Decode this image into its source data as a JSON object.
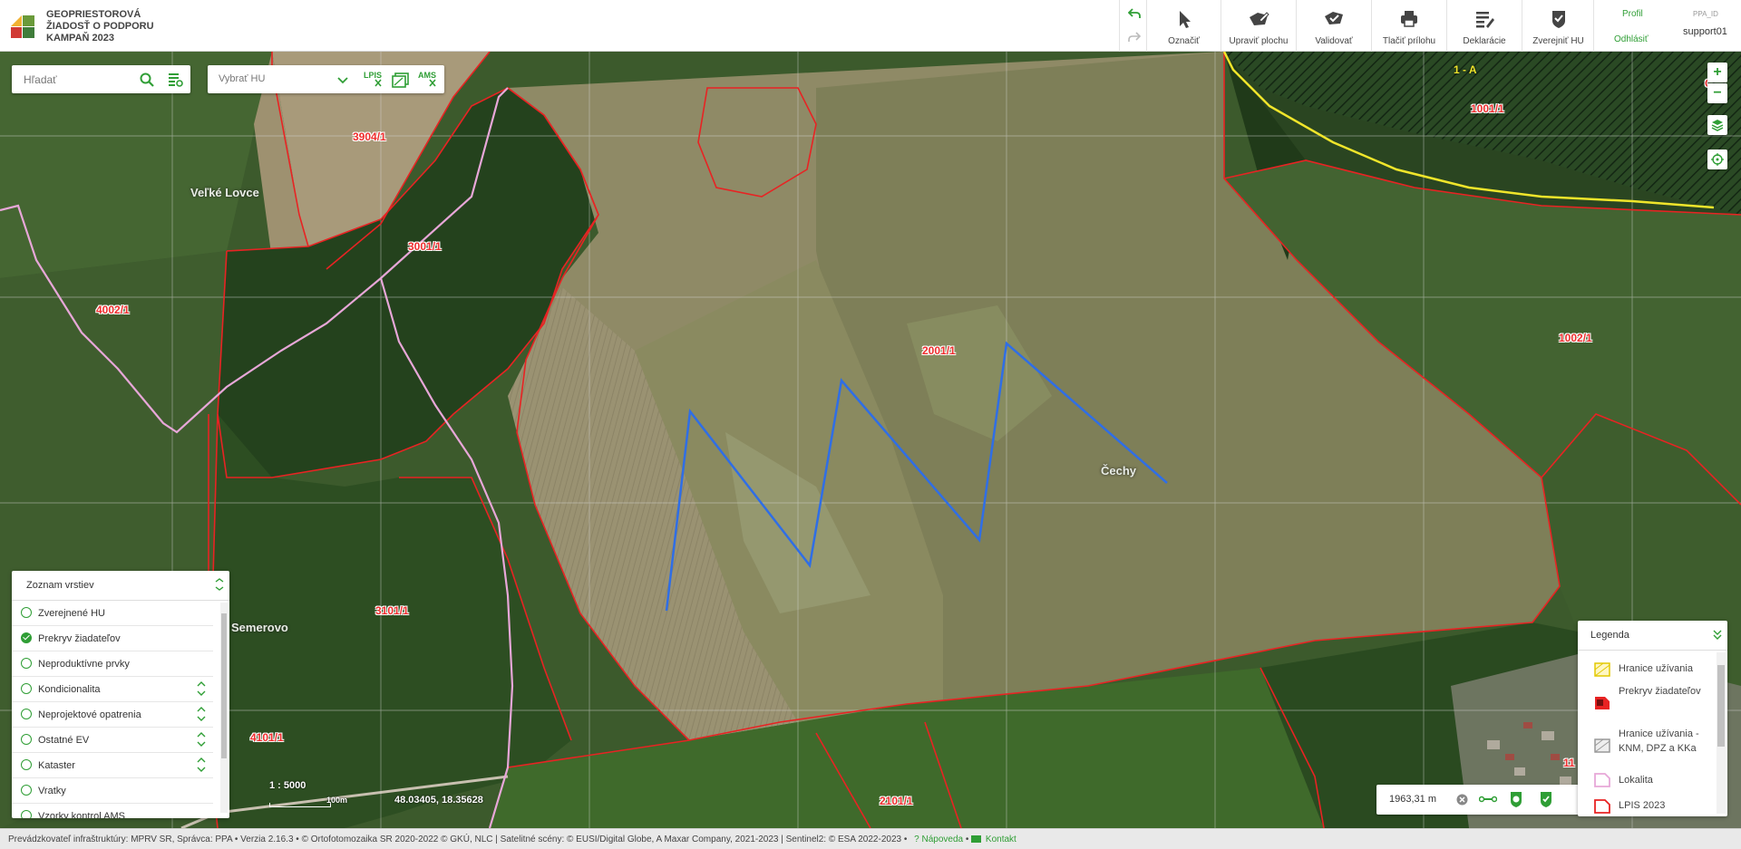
{
  "app": {
    "title_lines": [
      "GEOPRIESTOROVÁ",
      "ŽIADOSŤ O PODPORU",
      "KAMPAŇ 2023"
    ],
    "logo_colors": [
      "#f2b233",
      "#6a9a3a",
      "#d13a35",
      "#3f7d3a"
    ]
  },
  "header": {
    "undo_icon": "undo-icon",
    "redo_icon": "redo-icon",
    "toolbar": [
      {
        "id": "oznacit",
        "label": "Označiť",
        "icon": "cursor-icon"
      },
      {
        "id": "upravit",
        "label": "Upraviť plochu",
        "icon": "edit-area-icon"
      },
      {
        "id": "validovat",
        "label": "Validovať",
        "icon": "validate-icon"
      },
      {
        "id": "tlacit",
        "label": "Tlačiť prílohu",
        "icon": "print-icon"
      },
      {
        "id": "deklaracie",
        "label": "Deklarácie",
        "icon": "declaration-list-icon"
      },
      {
        "id": "zverejnit",
        "label": "Zverejniť HU",
        "icon": "shield-check-icon"
      }
    ],
    "user": {
      "profile_label": "Profil",
      "logout_label": "Odhlásiť",
      "id_label": "PPA_ID",
      "username": "support01"
    }
  },
  "map_controls": {
    "search_placeholder": "Hľadať",
    "hu_select_value": "Vybrať HU",
    "lpis_label": "LPIS",
    "ams_label": "AMS",
    "zoom_in": "+",
    "zoom_out": "−"
  },
  "map": {
    "parcel_labels": [
      {
        "text": "3904/1"
      },
      {
        "text": "3001/1"
      },
      {
        "text": "4002/1"
      },
      {
        "text": "2001/1"
      },
      {
        "text": "1001/1"
      },
      {
        "text": "1002/1"
      },
      {
        "text": "3101/1"
      },
      {
        "text": "4101/1"
      },
      {
        "text": "2101/1"
      },
      {
        "text": "1 - A"
      },
      {
        "text": "C"
      },
      {
        "text": "11"
      },
      {
        "text": "12"
      }
    ],
    "place_labels": [
      "Veľké Lovce",
      "Čechy",
      "Semerovo"
    ],
    "scale_text": "1 : 5000",
    "scale_bar_label": "100m",
    "coordinates": "48.03405, 18.35628",
    "measure_value": "1963,31 m"
  },
  "layers_panel": {
    "title": "Zoznam vrstiev",
    "items": [
      {
        "label": "Zverejnené HU",
        "checked": false,
        "sortable": false
      },
      {
        "label": "Prekryv žiadateľov",
        "checked": true,
        "sortable": false
      },
      {
        "label": "Neproduktívne prvky",
        "checked": false,
        "sortable": false
      },
      {
        "label": "Kondicionalita",
        "checked": false,
        "sortable": true
      },
      {
        "label": "Neprojektové opatrenia",
        "checked": false,
        "sortable": true
      },
      {
        "label": "Ostatné EV",
        "checked": false,
        "sortable": true
      },
      {
        "label": "Kataster",
        "checked": false,
        "sortable": true
      },
      {
        "label": "Vratky",
        "checked": false,
        "sortable": false
      },
      {
        "label": "Vzorky kontrol AMS",
        "checked": false,
        "sortable": false
      }
    ]
  },
  "legend": {
    "title": "Legenda",
    "items": [
      {
        "label": "Hranice užívania",
        "icon": "yellow-hatch-icon"
      },
      {
        "label": "Prekryv žiadateľov",
        "icon": "red-overlap-icon"
      },
      {
        "label": "Hranice užívania - KNM, DPZ a KKa",
        "icon": "gray-hatch-icon"
      },
      {
        "label": "Lokalita",
        "icon": "pink-line-icon"
      },
      {
        "label": "LPIS 2023",
        "icon": "red-line-icon"
      }
    ]
  },
  "footer": {
    "text": "Prevádzkovateľ infraštruktúry: MPRV SR, Správca: PPA • Verzia 2.16.3 • © Ortofotomozaika SR 2020-2022 © GKÚ, NLC | Satelitné scény: © EUSI/Digital Globe, A Maxar Company, 2021-2023 | Sentinel2: © ESA 2022-2023 •",
    "help_label": "Nápoveda",
    "contact_label": "Kontakt"
  },
  "colors": {
    "accent": "#2f9e35",
    "parcel_border": "#e82323",
    "drawn_line": "#2f6ee6",
    "locality_line": "#e7a7d8",
    "usage_boundary": "#f0e52b"
  }
}
